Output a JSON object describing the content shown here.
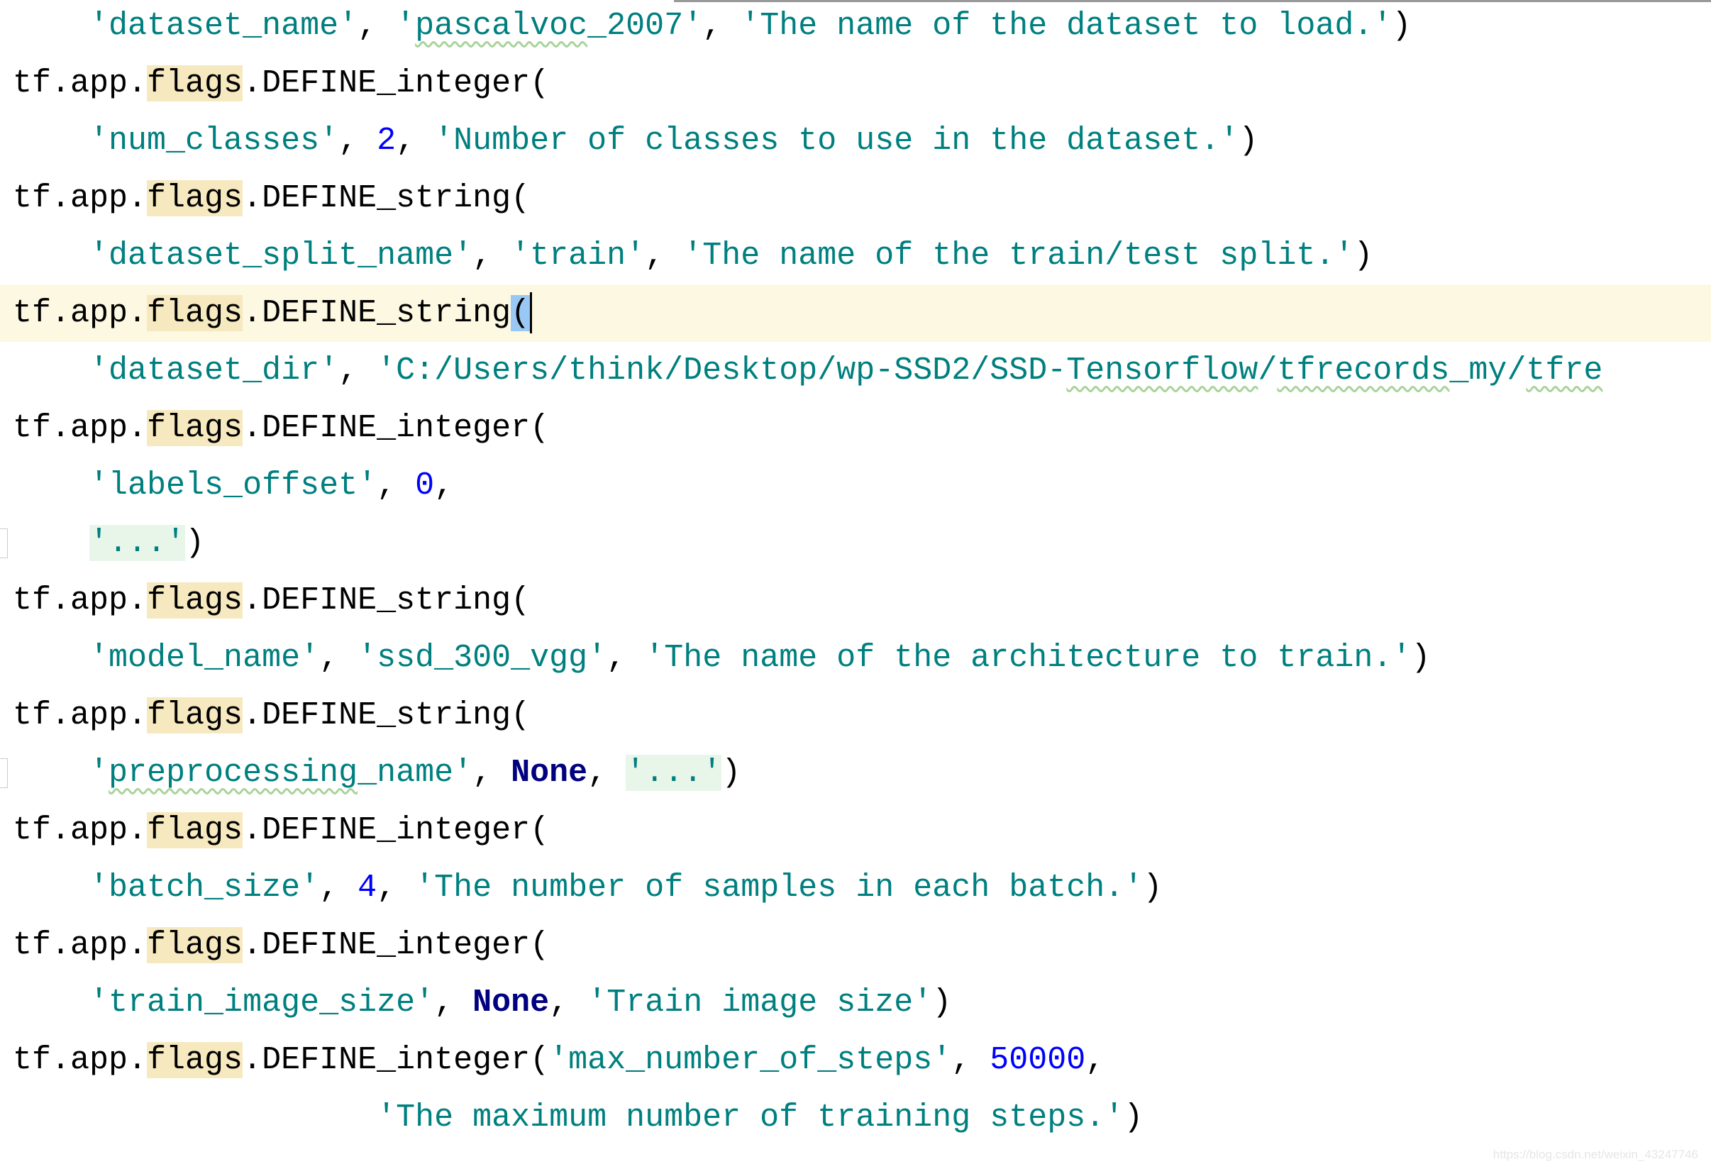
{
  "editor": {
    "current_line": 5,
    "lines": [
      [
        {
          "t": "    "
        },
        {
          "t": "'dataset_name'",
          "c": "str"
        },
        {
          "t": ", "
        },
        {
          "t": "'",
          "c": "str"
        },
        {
          "t": "pascalvoc",
          "c": "str squig"
        },
        {
          "t": "_2007'",
          "c": "str"
        },
        {
          "t": ", "
        },
        {
          "t": "'The name of the dataset to load.'",
          "c": "str"
        },
        {
          "t": ")"
        }
      ],
      [
        {
          "t": "tf.app."
        },
        {
          "t": "flags",
          "c": "flags"
        },
        {
          "t": ".DEFINE_integer("
        }
      ],
      [
        {
          "t": "    "
        },
        {
          "t": "'num_classes'",
          "c": "str"
        },
        {
          "t": ", "
        },
        {
          "t": "2",
          "c": "num"
        },
        {
          "t": ", "
        },
        {
          "t": "'Number of classes to use in the dataset.'",
          "c": "str"
        },
        {
          "t": ")"
        }
      ],
      [
        {
          "t": "tf.app."
        },
        {
          "t": "flags",
          "c": "flags"
        },
        {
          "t": ".DEFINE_string("
        }
      ],
      [
        {
          "t": "    "
        },
        {
          "t": "'dataset_split_name'",
          "c": "str"
        },
        {
          "t": ", "
        },
        {
          "t": "'train'",
          "c": "str"
        },
        {
          "t": ", "
        },
        {
          "t": "'The name of the train/test split.'",
          "c": "str"
        },
        {
          "t": ")"
        }
      ],
      [
        {
          "t": "tf.app."
        },
        {
          "t": "flags",
          "c": "flags"
        },
        {
          "t": ".DEFINE_string"
        },
        {
          "t": "(",
          "c": "bracket"
        },
        {
          "caret": true
        }
      ],
      [
        {
          "t": "    "
        },
        {
          "t": "'dataset_dir'",
          "c": "str"
        },
        {
          "t": ", "
        },
        {
          "t": "'C:/Users/think/Desktop/wp-SSD2/SSD-",
          "c": "str"
        },
        {
          "t": "Tensorflow",
          "c": "str squig"
        },
        {
          "t": "/",
          "c": "str"
        },
        {
          "t": "tfrecords",
          "c": "str squig"
        },
        {
          "t": "_my/",
          "c": "str"
        },
        {
          "t": "tfre",
          "c": "str squig"
        }
      ],
      [
        {
          "t": "tf.app."
        },
        {
          "t": "flags",
          "c": "flags"
        },
        {
          "t": ".DEFINE_integer("
        }
      ],
      [
        {
          "t": "    "
        },
        {
          "t": "'labels_offset'",
          "c": "str"
        },
        {
          "t": ", "
        },
        {
          "t": "0",
          "c": "num"
        },
        {
          "t": ","
        }
      ],
      [
        {
          "t": "    "
        },
        {
          "t": "'...'",
          "c": "fold"
        },
        {
          "t": ")"
        }
      ],
      [
        {
          "t": "tf.app."
        },
        {
          "t": "flags",
          "c": "flags"
        },
        {
          "t": ".DEFINE_string("
        }
      ],
      [
        {
          "t": "    "
        },
        {
          "t": "'model_name'",
          "c": "str"
        },
        {
          "t": ", "
        },
        {
          "t": "'ssd_300_vgg'",
          "c": "str"
        },
        {
          "t": ", "
        },
        {
          "t": "'The name of the architecture to train.'",
          "c": "str"
        },
        {
          "t": ")"
        }
      ],
      [
        {
          "t": "tf.app."
        },
        {
          "t": "flags",
          "c": "flags"
        },
        {
          "t": ".DEFINE_string("
        }
      ],
      [
        {
          "t": "    "
        },
        {
          "t": "'",
          "c": "str"
        },
        {
          "t": "preprocessing",
          "c": "str squig"
        },
        {
          "t": "_name'",
          "c": "str"
        },
        {
          "t": ", "
        },
        {
          "t": "None",
          "c": "kw"
        },
        {
          "t": ", "
        },
        {
          "t": "'...'",
          "c": "fold"
        },
        {
          "t": ")"
        }
      ],
      [
        {
          "t": "tf.app."
        },
        {
          "t": "flags",
          "c": "flags"
        },
        {
          "t": ".DEFINE_integer("
        }
      ],
      [
        {
          "t": "    "
        },
        {
          "t": "'batch_size'",
          "c": "str"
        },
        {
          "t": ", "
        },
        {
          "t": "4",
          "c": "num"
        },
        {
          "t": ", "
        },
        {
          "t": "'The number of samples in each batch.'",
          "c": "str"
        },
        {
          "t": ")"
        }
      ],
      [
        {
          "t": "tf.app."
        },
        {
          "t": "flags",
          "c": "flags"
        },
        {
          "t": ".DEFINE_integer("
        }
      ],
      [
        {
          "t": "    "
        },
        {
          "t": "'train_image_size'",
          "c": "str"
        },
        {
          "t": ", "
        },
        {
          "t": "None",
          "c": "kw"
        },
        {
          "t": ", "
        },
        {
          "t": "'Train image size'",
          "c": "str"
        },
        {
          "t": ")"
        }
      ],
      [
        {
          "t": "tf.app."
        },
        {
          "t": "flags",
          "c": "flags"
        },
        {
          "t": ".DEFINE_integer("
        },
        {
          "t": "'max_number_of_steps'",
          "c": "str"
        },
        {
          "t": ", "
        },
        {
          "t": "50000",
          "c": "num"
        },
        {
          "t": ","
        }
      ],
      [
        {
          "t": "                   "
        },
        {
          "t": "'The maximum number of training steps.'",
          "c": "str"
        },
        {
          "t": ")"
        }
      ]
    ],
    "fold_marker_lines": [
      9,
      13
    ]
  },
  "colors": {
    "string": "#007f7f",
    "number": "#0000ff",
    "keyword": "#000080",
    "flags_highlight": "#f6e9bf",
    "current_line": "#fdf8e2"
  },
  "watermark": "https://blog.csdn.net/weixin_43247746"
}
